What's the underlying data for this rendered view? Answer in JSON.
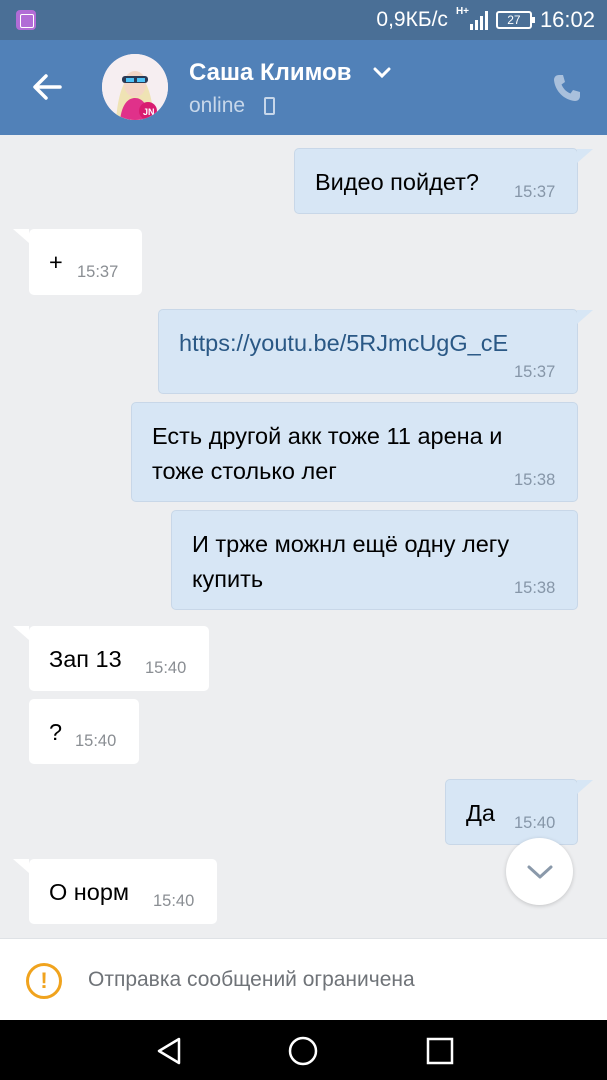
{
  "status_bar": {
    "net_speed": "0,9КБ/с",
    "network_type": "H+",
    "battery": "27",
    "time": "16:02",
    "notification_icon": "gallery-icon"
  },
  "header": {
    "contact_name": "Саша Климов",
    "status": "online",
    "back_icon": "arrow-left-icon",
    "call_icon": "phone-icon",
    "color": "#5181b8"
  },
  "messages": [
    {
      "dir": "out",
      "text": "Видео пойдет?",
      "time": "15:37"
    },
    {
      "dir": "in",
      "text": "+",
      "time": "15:37"
    },
    {
      "dir": "out",
      "text": "https://youtu.be/5RJmcUgG_cE",
      "time": "15:37",
      "is_link": true
    },
    {
      "dir": "out",
      "text_lines": [
        "Есть другой акк тоже 11 арена и",
        "тоже столько лег"
      ],
      "time": "15:38"
    },
    {
      "dir": "out",
      "text_lines": [
        "И трже можнл ещё одну легу",
        "купить"
      ],
      "time": "15:38"
    },
    {
      "dir": "in",
      "text": "Зап 13",
      "time": "15:40"
    },
    {
      "dir": "in",
      "text": "?",
      "time": "15:40"
    },
    {
      "dir": "out",
      "text": "Да",
      "time": "15:40"
    },
    {
      "dir": "in",
      "text": "О норм",
      "time": "15:40"
    }
  ],
  "footer": {
    "restriction_text": "Отправка сообщений ограничена",
    "warning_color": "#f0a31e"
  }
}
